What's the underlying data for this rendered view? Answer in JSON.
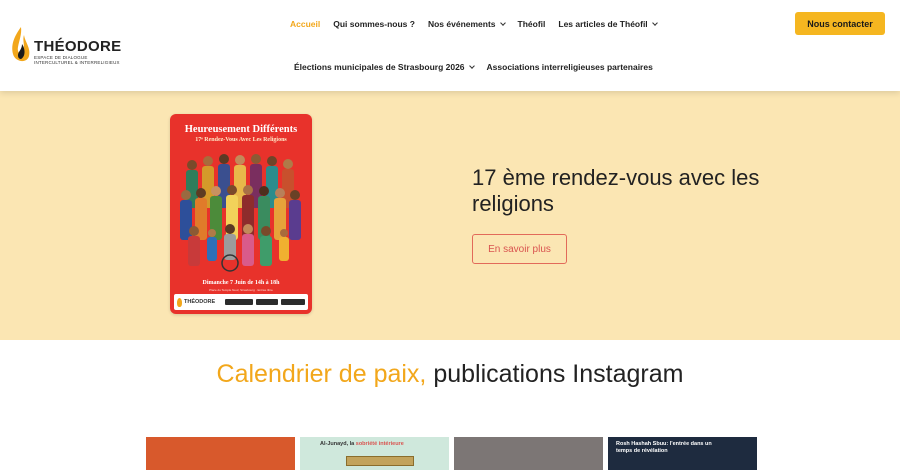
{
  "header": {
    "logo": {
      "brand": "THÉODORE",
      "tagline_1": "espace de dialogue",
      "tagline_2": "interculturel & interreligieux"
    },
    "nav_row_1": [
      {
        "label": "Accueil",
        "active": true,
        "dropdown": false
      },
      {
        "label": "Qui sommes-nous ?",
        "active": false,
        "dropdown": false
      },
      {
        "label": "Nos événements",
        "active": false,
        "dropdown": true
      },
      {
        "label": "Théofil",
        "active": false,
        "dropdown": false
      },
      {
        "label": "Les articles de Théofil",
        "active": false,
        "dropdown": true
      }
    ],
    "nav_row_2": [
      {
        "label": "Élections municipales de Strasbourg 2026",
        "active": false,
        "dropdown": true
      },
      {
        "label": "Associations interreligieuses partenaires",
        "active": false,
        "dropdown": false
      }
    ],
    "contact_button": "Nous contacter"
  },
  "hero": {
    "poster": {
      "title": "Heureusement Différents",
      "subtitle": "17ᵉ Rendez-Vous Avec Les Religions",
      "date": "Dimanche 7 Juin de 14h à 18h",
      "place": "Place du Temple Neuf, Strasbourg · Entrée libre",
      "footer_brand": "THÉODORE"
    },
    "title": "17 ème rendez-vous avec les religions",
    "button": "En savoir plus"
  },
  "section": {
    "title_accent": "Calendrier de paix,",
    "title_rest": " publications Instagram"
  },
  "instagram": {
    "post_2_caption_a": "Al-Junayd, la ",
    "post_2_caption_b": "sobriété intérieure",
    "post_4_caption": "Rosh Hashah Sbuu: l'entrée dans un temps de révélation"
  },
  "colors": {
    "accent": "#f2a71b",
    "contact_button": "#f5b620",
    "hero_background": "#fbe6b3",
    "poster_red": "#e8322b",
    "button_border": "#e26a5a"
  }
}
